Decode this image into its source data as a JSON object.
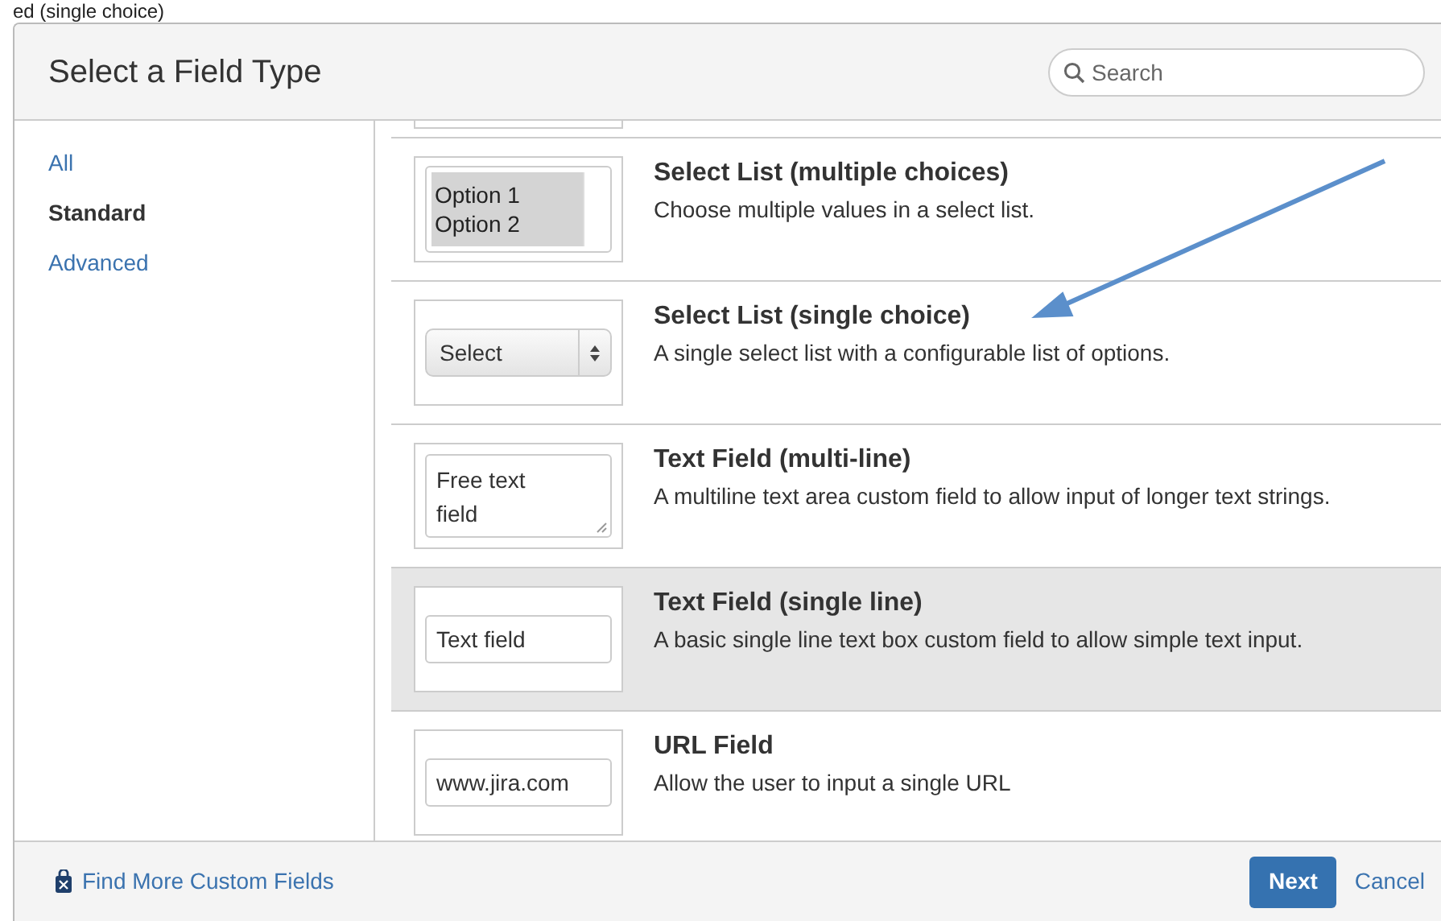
{
  "caption": "ed (single choice)",
  "dialog": {
    "title": "Select a Field Type",
    "search": {
      "placeholder": "Search"
    }
  },
  "sidebar": {
    "items": [
      {
        "label": "All",
        "selected": false
      },
      {
        "label": "Standard",
        "selected": true
      },
      {
        "label": "Advanced",
        "selected": false
      }
    ]
  },
  "field_types": [
    {
      "kind": "multi_select",
      "name": "Select List (multiple choices)",
      "description": "Choose multiple values in a select list.",
      "preview": [
        "Option 1",
        "Option 2"
      ],
      "selected": false
    },
    {
      "kind": "select",
      "name": "Select List (single choice)",
      "description": "A single select list with a configurable list of options.",
      "preview": [
        "Select"
      ],
      "selected": false
    },
    {
      "kind": "textarea",
      "name": "Text Field (multi-line)",
      "description": "A multiline text area custom field to allow input of longer text strings.",
      "preview": [
        "Free text field"
      ],
      "selected": false
    },
    {
      "kind": "text",
      "name": "Text Field (single line)",
      "description": "A basic single line text box custom field to allow simple text input.",
      "preview": [
        "Text field"
      ],
      "selected": true
    },
    {
      "kind": "text",
      "name": "URL Field",
      "description": "Allow the user to input a single URL",
      "preview": [
        "www.jira.com"
      ],
      "selected": false
    }
  ],
  "footer": {
    "link": "Find More Custom Fields",
    "buttons": [
      {
        "label": "Next",
        "kind": "primary"
      },
      {
        "label": "Cancel",
        "kind": "link"
      }
    ]
  }
}
